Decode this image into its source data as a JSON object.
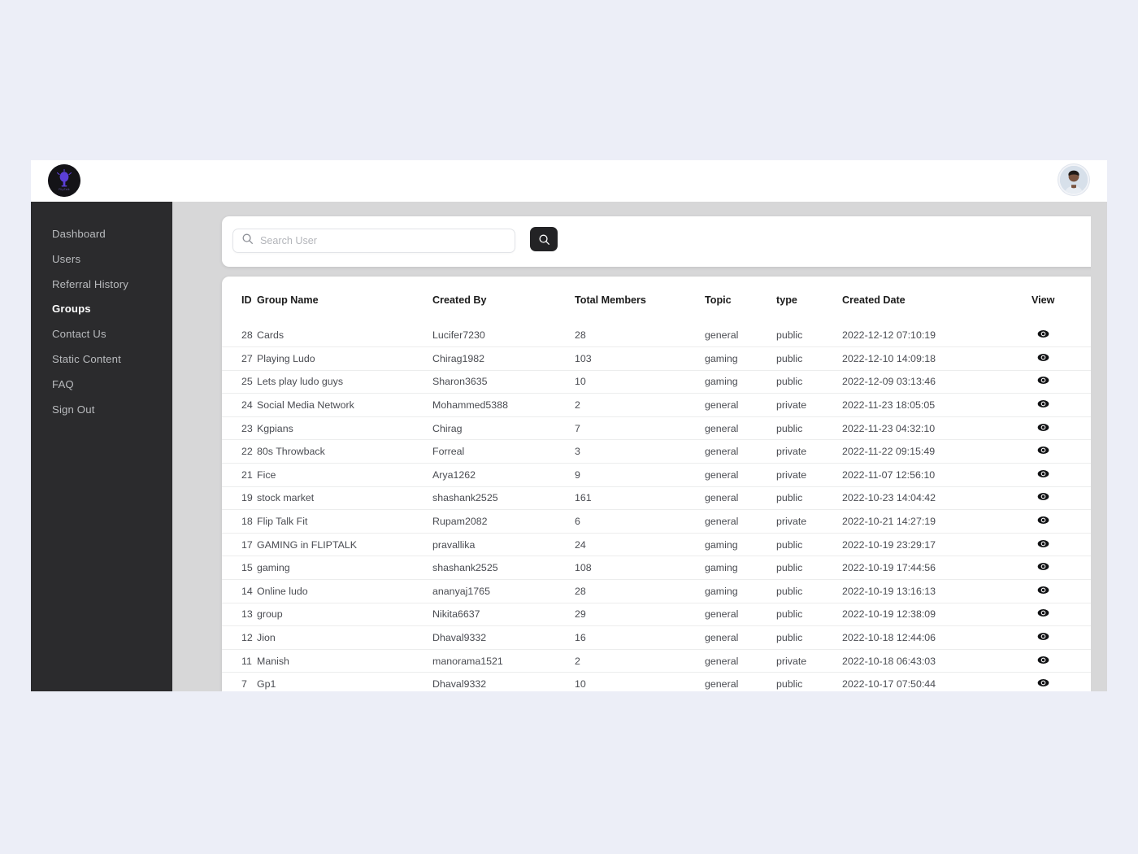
{
  "window": {
    "background_color": "#eceef7",
    "content_background": "#d7d7d8",
    "sidebar_background": "#2b2b2d"
  },
  "topbar": {
    "logo_icon": "fliptalk-logo-icon",
    "logo_alt": "FlipTalk",
    "avatar_icon": "user-avatar-icon"
  },
  "sidebar": {
    "items": [
      {
        "label": "Dashboard",
        "active": false
      },
      {
        "label": "Users",
        "active": false
      },
      {
        "label": "Referral History",
        "active": false
      },
      {
        "label": "Groups",
        "active": true
      },
      {
        "label": "Contact Us",
        "active": false
      },
      {
        "label": "Static Content",
        "active": false
      },
      {
        "label": "FAQ",
        "active": false
      },
      {
        "label": "Sign Out",
        "active": false
      }
    ]
  },
  "search": {
    "placeholder": "Search User",
    "value": "",
    "input_icon": "search-icon",
    "button_icon": "search-icon",
    "button_color": "#232325"
  },
  "table": {
    "columns": [
      "ID",
      "Group Name",
      "Created By",
      "Total Members",
      "Topic",
      "type",
      "Created Date",
      "View"
    ],
    "row_action_icon": "eye-icon",
    "rows": [
      {
        "id": "28",
        "group_name": "Cards",
        "created_by": "Lucifer7230",
        "total_members": "28",
        "topic": "general",
        "type": "public",
        "created_date": "2022-12-12 07:10:19"
      },
      {
        "id": "27",
        "group_name": "Playing Ludo",
        "created_by": "Chirag1982",
        "total_members": "103",
        "topic": "gaming",
        "type": "public",
        "created_date": "2022-12-10 14:09:18"
      },
      {
        "id": "25",
        "group_name": "Lets play ludo guys",
        "created_by": "Sharon3635",
        "total_members": "10",
        "topic": "gaming",
        "type": "public",
        "created_date": "2022-12-09 03:13:46"
      },
      {
        "id": "24",
        "group_name": "Social Media Network",
        "created_by": "Mohammed5388",
        "total_members": "2",
        "topic": "general",
        "type": "private",
        "created_date": "2022-11-23 18:05:05"
      },
      {
        "id": "23",
        "group_name": "Kgpians",
        "created_by": "Chirag",
        "total_members": "7",
        "topic": "general",
        "type": "public",
        "created_date": "2022-11-23 04:32:10"
      },
      {
        "id": "22",
        "group_name": "80s Throwback",
        "created_by": "Forreal",
        "total_members": "3",
        "topic": "general",
        "type": "private",
        "created_date": "2022-11-22 09:15:49"
      },
      {
        "id": "21",
        "group_name": "Fice",
        "created_by": "Arya1262",
        "total_members": "9",
        "topic": "general",
        "type": "private",
        "created_date": "2022-11-07 12:56:10"
      },
      {
        "id": "19",
        "group_name": "stock market",
        "created_by": "shashank2525",
        "total_members": "161",
        "topic": "general",
        "type": "public",
        "created_date": "2022-10-23 14:04:42"
      },
      {
        "id": "18",
        "group_name": "Flip Talk Fit",
        "created_by": "Rupam2082",
        "total_members": "6",
        "topic": "general",
        "type": "private",
        "created_date": "2022-10-21 14:27:19"
      },
      {
        "id": "17",
        "group_name": "GAMING in FLIPTALK",
        "created_by": "pravallika",
        "total_members": "24",
        "topic": "gaming",
        "type": "public",
        "created_date": "2022-10-19 23:29:17"
      },
      {
        "id": "15",
        "group_name": "gaming",
        "created_by": "shashank2525",
        "total_members": "108",
        "topic": "gaming",
        "type": "public",
        "created_date": "2022-10-19 17:44:56"
      },
      {
        "id": "14",
        "group_name": "Online ludo",
        "created_by": "ananyaj1765",
        "total_members": "28",
        "topic": "gaming",
        "type": "public",
        "created_date": "2022-10-19 13:16:13"
      },
      {
        "id": "13",
        "group_name": "group",
        "created_by": "Nikita6637",
        "total_members": "29",
        "topic": "general",
        "type": "public",
        "created_date": "2022-10-19 12:38:09"
      },
      {
        "id": "12",
        "group_name": "Jion",
        "created_by": "Dhaval9332",
        "total_members": "16",
        "topic": "general",
        "type": "public",
        "created_date": "2022-10-18 12:44:06"
      },
      {
        "id": "11",
        "group_name": "Manish",
        "created_by": "manorama1521",
        "total_members": "2",
        "topic": "general",
        "type": "private",
        "created_date": "2022-10-18 06:43:03"
      },
      {
        "id": "7",
        "group_name": "Gp1",
        "created_by": "Dhaval9332",
        "total_members": "10",
        "topic": "general",
        "type": "public",
        "created_date": "2022-10-17 07:50:44"
      }
    ]
  }
}
